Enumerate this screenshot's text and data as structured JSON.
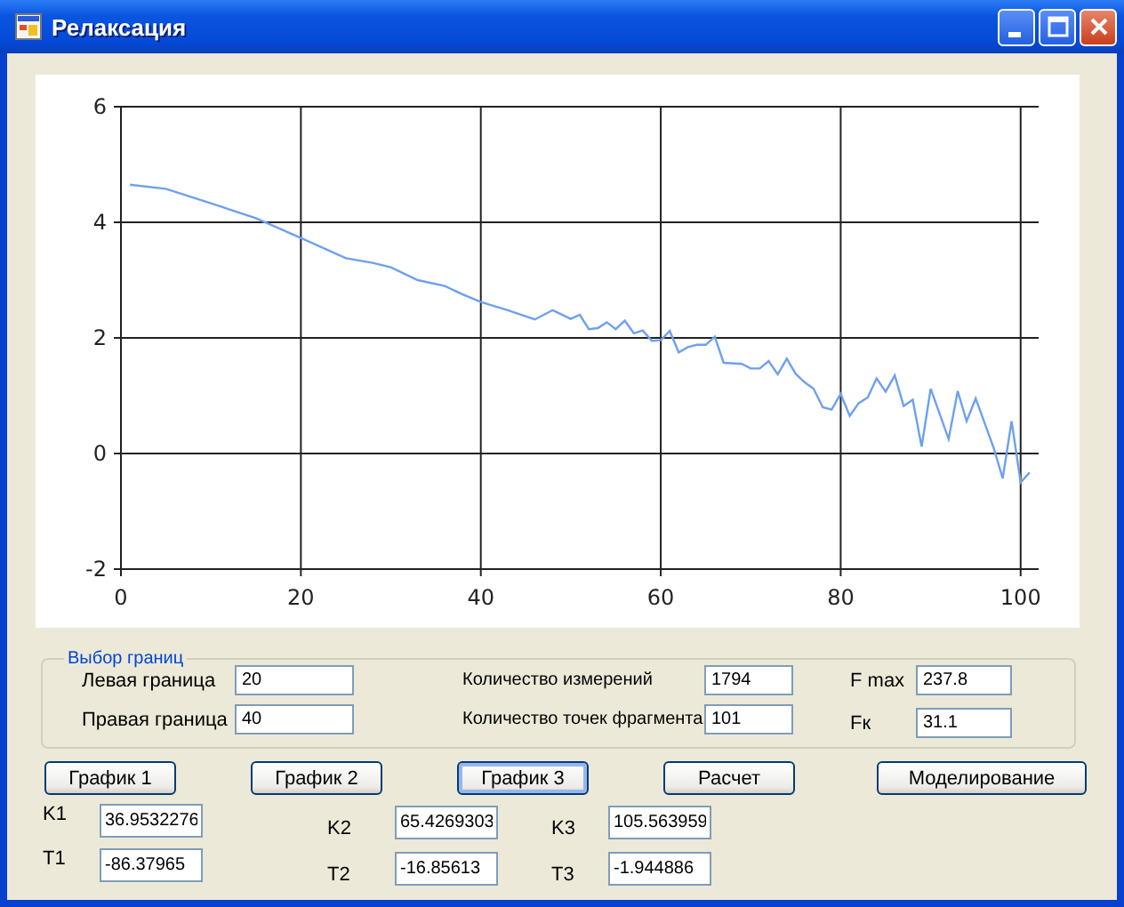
{
  "window": {
    "title": "Релаксация"
  },
  "chart_data": {
    "type": "line",
    "x": [
      1,
      5,
      10,
      15,
      20,
      25,
      28,
      30,
      33,
      36,
      38,
      40,
      43,
      46,
      48,
      50,
      51,
      52,
      53,
      54,
      55,
      56,
      57,
      58,
      59,
      60,
      61,
      62,
      63,
      64,
      65,
      66,
      67,
      69,
      70,
      71,
      72,
      73,
      74,
      75,
      76,
      77,
      78,
      79,
      80,
      81,
      82,
      83,
      84,
      85,
      86,
      87,
      88,
      89,
      90,
      92,
      93,
      94,
      95,
      97,
      98,
      99,
      100,
      101
    ],
    "series": [
      {
        "color": "#6ea0f0",
        "values": [
          4.65,
          4.58,
          4.33,
          4.07,
          3.73,
          3.38,
          3.3,
          3.22,
          3.0,
          2.9,
          2.75,
          2.62,
          2.48,
          2.32,
          2.48,
          2.33,
          2.4,
          2.15,
          2.17,
          2.27,
          2.15,
          2.3,
          2.08,
          2.13,
          1.95,
          1.96,
          2.12,
          1.75,
          1.84,
          1.88,
          1.88,
          2.02,
          1.57,
          1.55,
          1.47,
          1.47,
          1.6,
          1.37,
          1.64,
          1.38,
          1.23,
          1.12,
          0.8,
          0.76,
          1.03,
          0.65,
          0.87,
          0.97,
          1.3,
          1.07,
          1.35,
          0.82,
          0.93,
          0.12,
          1.12,
          0.25,
          1.08,
          0.56,
          0.95,
          0.1,
          -0.43,
          0.56,
          -0.5,
          -0.33
        ]
      }
    ],
    "grid": true,
    "xlim": [
      0,
      102
    ],
    "ylim": [
      -2,
      6
    ],
    "xticks": [
      0,
      20,
      40,
      60,
      80,
      100
    ],
    "yticks": [
      -2,
      0,
      2,
      4,
      6
    ]
  },
  "bounds_group": {
    "title": "Выбор границ",
    "columns": [
      [
        {
          "label": "Левая граница",
          "value": "20"
        },
        {
          "label": "Правая граница",
          "value": "40"
        }
      ],
      [
        {
          "label": "Количество измерений",
          "value": "1794"
        },
        {
          "label": "Количество точек фрагмента",
          "value": "101"
        }
      ],
      [
        {
          "label": "F max",
          "value": "237.8"
        },
        {
          "label": "Fк",
          "value": "31.1"
        }
      ]
    ]
  },
  "buttons": [
    {
      "label": "График 1",
      "selected": false
    },
    {
      "label": "График 2",
      "selected": false
    },
    {
      "label": "График 3",
      "selected": true
    },
    {
      "label": "Расчет",
      "selected": false
    },
    {
      "label": "Моделирование",
      "selected": false
    }
  ],
  "results": [
    [
      {
        "label": "K1",
        "value": "36.9532276"
      },
      {
        "label": "T1",
        "value": "-86.37965"
      }
    ],
    [
      {
        "label": "K2",
        "value": "65.4269303"
      },
      {
        "label": "T2",
        "value": "-16.85613"
      }
    ],
    [
      {
        "label": "K3",
        "value": "105.563959"
      },
      {
        "label": "T3",
        "value": "-1.944886"
      }
    ]
  ]
}
